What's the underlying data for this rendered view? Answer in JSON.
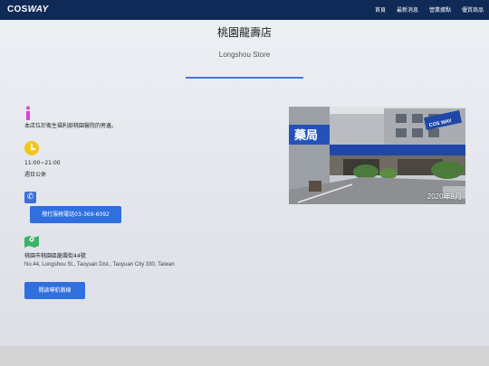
{
  "header": {
    "logo_prefix": "COS",
    "logo_suffix": "WAY",
    "nav": [
      "首頁",
      "最新消息",
      "營業據點",
      "優質商品"
    ]
  },
  "store": {
    "title": "桃園龍壽店",
    "subtitle": "Longshou Store"
  },
  "info": {
    "notice": "本店位於衛生福利部桃園醫院的旁邊。",
    "hours": "11:00~21:00",
    "closed": "週日公休",
    "call_label": "撥打服務電話03-369-6092",
    "address_zh": "桃園市桃園區龍壽街44號",
    "address_en": "No.44, Longshou St., Taoyuan Dist., Taoyuan City 330, Taiwan",
    "navigate_label": "開啟導航路線"
  },
  "photo": {
    "date": "2020年9月",
    "sign_left": "藥局",
    "sign_right": "COS WAY"
  },
  "colors": {
    "navbar": "#0f2a57",
    "accent": "#2f6fe0",
    "info_icon": "#e040d8",
    "clock_icon": "#f4c61a",
    "map_icon": "#3bb36a"
  },
  "icons": {
    "info": "info-icon",
    "clock": "clock-icon",
    "phone": "phone-icon",
    "map": "map-icon"
  }
}
